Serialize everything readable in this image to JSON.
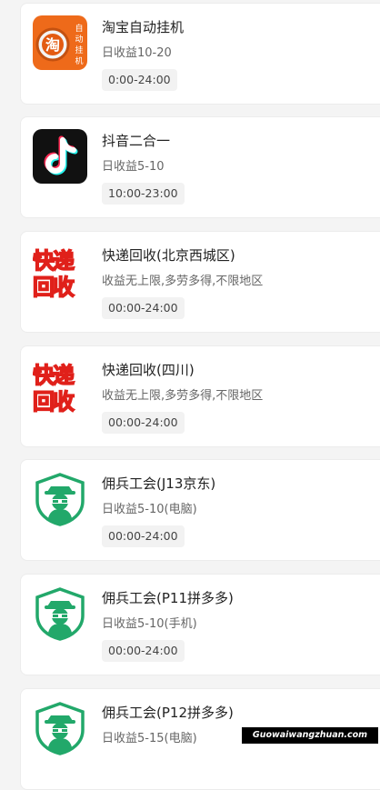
{
  "items": [
    {
      "title": "淘宝自动挂机",
      "income": "日收益10-20",
      "time": "0:00-24:00",
      "icon": "taobao-icon",
      "logo_text": "淘",
      "logo_side": "自动挂机"
    },
    {
      "title": "抖音二合一",
      "income": "日收益5-10",
      "time": "10:00-23:00",
      "icon": "tiktok-icon"
    },
    {
      "title": "快递回收(北京西城区)",
      "income": "收益无上限,多劳多得,不限地区",
      "time": "00:00-24:00",
      "icon": "express-recycle-icon",
      "logo_text": "快递回收"
    },
    {
      "title": "快递回收(四川)",
      "income": "收益无上限,多劳多得,不限地区",
      "time": "00:00-24:00",
      "icon": "express-recycle-icon",
      "logo_text": "快递回收"
    },
    {
      "title": "佣兵工会(J13京东)",
      "income": "日收益5-10(电脑)",
      "time": "00:00-24:00",
      "icon": "mercenary-guild-icon"
    },
    {
      "title": "佣兵工会(P11拼多多)",
      "income": "日收益5-10(手机)",
      "time": "00:00-24:00",
      "icon": "mercenary-guild-icon"
    },
    {
      "title": "佣兵工会(P12拼多多)",
      "income": "日收益5-15(电脑)",
      "time": "",
      "icon": "mercenary-guild-icon"
    }
  ],
  "watermark": "Guowaiwangzhuan.com",
  "colors": {
    "taobao": "#ee6a1a",
    "guild_green": "#22a86a",
    "express_red": "#e0201a",
    "express_yellow": "#f6c21a"
  }
}
